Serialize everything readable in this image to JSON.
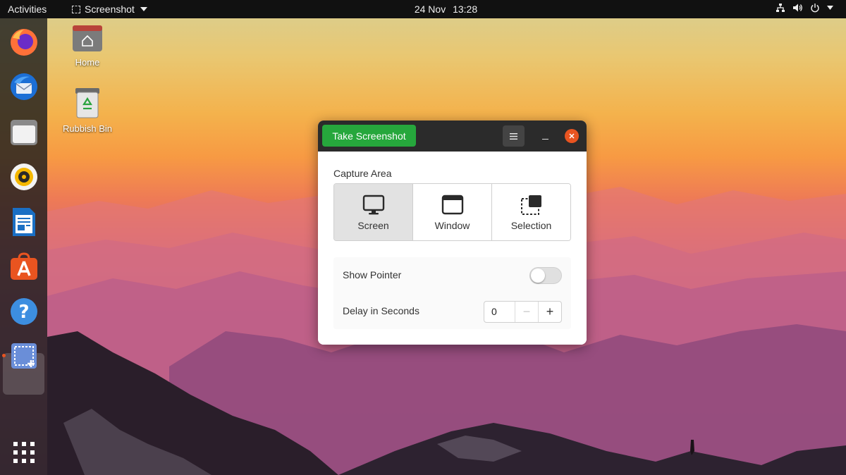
{
  "topbar": {
    "activities": "Activities",
    "app_name": "Screenshot",
    "date": "24 Nov",
    "time": "13:28"
  },
  "dock": {
    "items": [
      "firefox-icon",
      "thunderbird-icon",
      "files-icon",
      "rhythmbox-icon",
      "writer-icon",
      "software-icon",
      "help-icon",
      "screenshot-icon",
      "show-apps-icon"
    ]
  },
  "desktop": {
    "home_label": "Home",
    "bin_label": "Rubbish Bin"
  },
  "window": {
    "take_screenshot": "Take Screenshot",
    "capture_area_label": "Capture Area",
    "options": [
      {
        "label": "Screen",
        "icon": "monitor-icon",
        "active": true
      },
      {
        "label": "Window",
        "icon": "window-icon",
        "active": false
      },
      {
        "label": "Selection",
        "icon": "selection-icon",
        "active": false
      }
    ],
    "show_pointer_label": "Show Pointer",
    "show_pointer_on": false,
    "delay_label": "Delay in Seconds",
    "delay_value": "0",
    "minus": "−",
    "plus": "+"
  },
  "colors": {
    "accent_green": "#26a73c",
    "close_orange": "#e95420",
    "headerbar": "#2b2b2b"
  }
}
